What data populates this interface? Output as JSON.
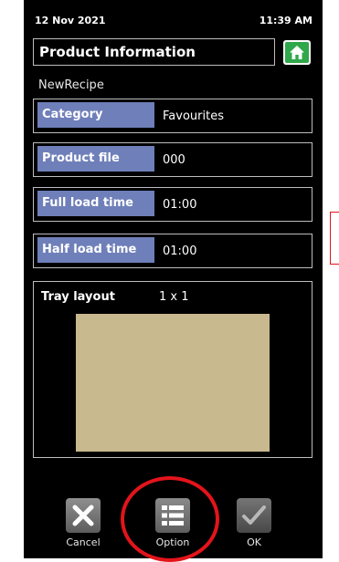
{
  "status": {
    "date": "12 Nov 2021",
    "time": "11:39 AM"
  },
  "header": {
    "title": "Product Information",
    "home_icon": "home-icon"
  },
  "recipe": {
    "name": "NewRecipe"
  },
  "fields": [
    {
      "label": "Category",
      "value": "Favourites"
    },
    {
      "label": "Product file",
      "value": "000"
    },
    {
      "label": "Full load time",
      "value": "01:00"
    },
    {
      "label": "Half load time",
      "value": "01:00"
    }
  ],
  "tray": {
    "label": "Tray layout",
    "value": "1 x 1"
  },
  "buttons": {
    "cancel": {
      "label": "Cancel",
      "icon": "close-icon"
    },
    "option": {
      "label": "Option",
      "icon": "list-icon"
    },
    "ok": {
      "label": "OK",
      "icon": "checkmark-icon"
    }
  },
  "colors": {
    "screen_background": "#000000",
    "label_background": "#6f7fb9",
    "tray_fill": "#c8b98e",
    "home_green": "#2ea84a",
    "annotation_red": "#e3141b"
  }
}
